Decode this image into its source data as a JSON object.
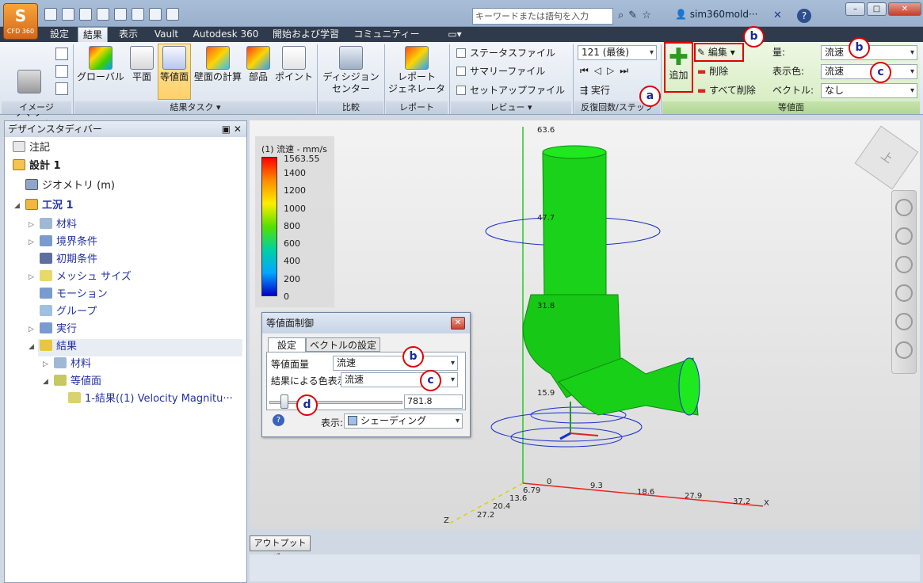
{
  "app": {
    "logo_text": "CFD 360",
    "search_placeholder": "キーワードまたは語句を入力",
    "user": "sim360mold···"
  },
  "tabs": [
    "設定",
    "結果",
    "表示",
    "Vault",
    "Autodesk 360",
    "開始および学習",
    "コミュニティー"
  ],
  "ribbon": {
    "image": {
      "summary": "サマリー\nイメージ",
      "group": "イメージ"
    },
    "tasks": {
      "items": [
        "グローバル",
        "平面",
        "等値面",
        "壁面の計算",
        "部品",
        "ポイント"
      ],
      "group": "結果タスク"
    },
    "compare": {
      "decision": "ディシジョン\nセンター",
      "group": "比較"
    },
    "report": {
      "generator": "レポート\nジェネレータ",
      "group": "レポート"
    },
    "review": {
      "items": [
        "ステータスファイル",
        "サマリーファイル",
        "セットアップファイル"
      ],
      "group": "レビュー"
    },
    "iterations": {
      "value": "121 (最後)",
      "run": "実行",
      "group": "反復回数/ステップ"
    },
    "isosurface": {
      "add": "追加",
      "edit": "編集",
      "delete": "削除",
      "delete_all": "すべて削除",
      "quantity_label": "量:",
      "quantity_value": "流速",
      "color_label": "表示色:",
      "color_value": "流速",
      "vector_label": "ベクトル:",
      "vector_value": "なし",
      "group": "等値面"
    }
  },
  "callouts": {
    "a": "a",
    "b": "b",
    "c": "c",
    "d": "d"
  },
  "design_panel": {
    "title": "デザインスタディバー",
    "tree": [
      {
        "label": "注記"
      },
      {
        "label": "設計 1"
      },
      {
        "label": "ジオメトリ (m)"
      },
      {
        "label": "工況 1"
      },
      {
        "label": "材料"
      },
      {
        "label": "境界条件"
      },
      {
        "label": "初期条件"
      },
      {
        "label": "メッシュ サイズ"
      },
      {
        "label": "モーション"
      },
      {
        "label": "グループ"
      },
      {
        "label": "実行"
      },
      {
        "label": "結果"
      },
      {
        "label": "材料"
      },
      {
        "label": "等値面"
      },
      {
        "label": "1-結果((1) Velocity Magnitu···"
      }
    ]
  },
  "legend": {
    "title": "(1) 流速 - mm/s",
    "ticks": [
      "1563.55",
      "1400",
      "1200",
      "1000",
      "800",
      "600",
      "400",
      "200",
      "0"
    ]
  },
  "viewport": {
    "z_ticks": [
      "63.6",
      "47.7",
      "31.8",
      "15.9"
    ],
    "x_ticks": [
      "0",
      "9.3",
      "18.6",
      "27.9",
      "37.2"
    ],
    "y_ticks": [
      "6.79",
      "13.6",
      "20.4",
      "27.2"
    ],
    "x_axis": "X",
    "z_axis": "Z",
    "viewcube_label": "上"
  },
  "dialog": {
    "title": "等値面制御",
    "tabs": [
      "設定",
      "ベクトルの設定"
    ],
    "quantity_label": "等値面量",
    "quantity_value": "流速",
    "color_label": "結果による色表示",
    "color_value": "流速",
    "slider_value": "781.8",
    "display_label": "表示:",
    "display_value": "シェーディング"
  },
  "output_bar": "アウトプットバー",
  "colors": {
    "accent": "#e00000",
    "callout_text": "#1a2a9a",
    "model": "#19d219"
  }
}
